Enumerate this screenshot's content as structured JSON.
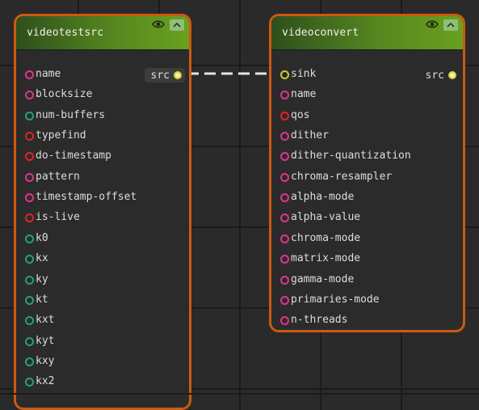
{
  "nodes": {
    "videotestsrc": {
      "title": "videotestsrc",
      "src_pad": "src",
      "properties": [
        {
          "label": "name",
          "color": "pink"
        },
        {
          "label": "blocksize",
          "color": "pink"
        },
        {
          "label": "num-buffers",
          "color": "green"
        },
        {
          "label": "typefind",
          "color": "red"
        },
        {
          "label": "do-timestamp",
          "color": "red"
        },
        {
          "label": "pattern",
          "color": "pink"
        },
        {
          "label": "timestamp-offset",
          "color": "pink"
        },
        {
          "label": "is-live",
          "color": "red"
        },
        {
          "label": "k0",
          "color": "green"
        },
        {
          "label": "kx",
          "color": "green"
        },
        {
          "label": "ky",
          "color": "green"
        },
        {
          "label": "kt",
          "color": "green"
        },
        {
          "label": "kxt",
          "color": "green"
        },
        {
          "label": "kyt",
          "color": "green"
        },
        {
          "label": "kxy",
          "color": "green"
        },
        {
          "label": "kx2",
          "color": "green"
        }
      ]
    },
    "videoconvert": {
      "title": "videoconvert",
      "src_pad": "src",
      "properties": [
        {
          "label": "sink",
          "color": "yellow"
        },
        {
          "label": "name",
          "color": "pink"
        },
        {
          "label": "qos",
          "color": "red"
        },
        {
          "label": "dither",
          "color": "pink"
        },
        {
          "label": "dither-quantization",
          "color": "pink"
        },
        {
          "label": "chroma-resampler",
          "color": "pink"
        },
        {
          "label": "alpha-mode",
          "color": "pink"
        },
        {
          "label": "alpha-value",
          "color": "pink"
        },
        {
          "label": "chroma-mode",
          "color": "pink"
        },
        {
          "label": "matrix-mode",
          "color": "pink"
        },
        {
          "label": "gamma-mode",
          "color": "pink"
        },
        {
          "label": "primaries-mode",
          "color": "pink"
        },
        {
          "label": "n-threads",
          "color": "pink"
        }
      ]
    }
  },
  "colors": {
    "node_border": "#cc5a0f",
    "header_gradient_start": "#2e4f1c",
    "header_gradient_end": "#6aa11f",
    "pad_pink": "#e0338f",
    "pad_red": "#e0222b",
    "pad_green": "#1fa37a",
    "pad_yellow": "#c8cf2a",
    "link": "#e6e6e6"
  },
  "icons": {
    "visibility": "eye-icon",
    "collapse": "chevron-up-icon"
  }
}
